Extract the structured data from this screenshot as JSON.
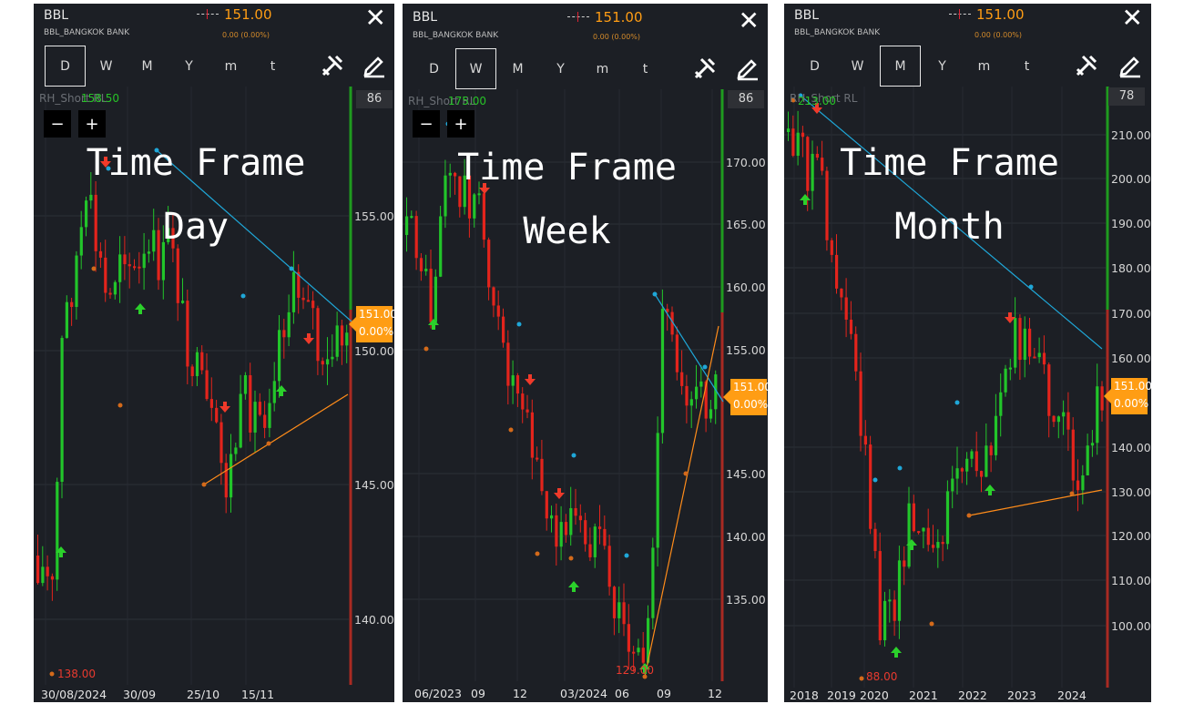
{
  "panels": [
    {
      "symbol": "BBL",
      "subtitle": "BBL_BANGKOK BANK",
      "price": "151.00",
      "change": "0.00 (0.00%)",
      "timeframes": [
        "D",
        "W",
        "M",
        "Y",
        "m",
        "t"
      ],
      "selected": 0,
      "indicator": "RH_Short RL",
      "top_value": "86",
      "high_label": "158.50",
      "low_label": "138.00",
      "overlay_line1": "Time Frame",
      "overlay_line2": "Day",
      "zoom_minus": "−",
      "zoom_plus": "+",
      "price_tag": "151.00",
      "price_tag_pct": "0.00%",
      "y_labels": [
        "155.00",
        "150.00",
        "145.00",
        "140.00"
      ],
      "x_labels": [
        "30/08/2024",
        "30/09",
        "25/10",
        "15/11"
      ]
    },
    {
      "symbol": "BBL",
      "subtitle": "BBL_BANGKOK BANK",
      "price": "151.00",
      "change": "0.00 (0.00%)",
      "timeframes": [
        "D",
        "W",
        "M",
        "Y",
        "m",
        "t"
      ],
      "selected": 1,
      "indicator": "RH_Short RL",
      "top_value": "86",
      "high_label": "175.00",
      "low_label": "129.00",
      "overlay_line1": "Time Frame",
      "overlay_line2": "Week",
      "zoom_minus": "−",
      "zoom_plus": "+",
      "price_tag": "151.00",
      "price_tag_pct": "0.00%",
      "y_labels": [
        "170.00",
        "165.00",
        "160.00",
        "155.00",
        "145.00",
        "140.00",
        "135.00"
      ],
      "x_labels": [
        "06/2023",
        "09",
        "12",
        "03/2024",
        "06",
        "09",
        "12"
      ]
    },
    {
      "symbol": "BBL",
      "subtitle": "BBL_BANGKOK BANK",
      "price": "151.00",
      "change": "0.00 (0.00%)",
      "timeframes": [
        "D",
        "W",
        "M",
        "Y",
        "m",
        "t"
      ],
      "selected": 2,
      "indicator": "RH_Short RL",
      "top_value": "78",
      "high_label": "213.00",
      "low_label": "88.00",
      "overlay_line1": "Time Frame",
      "overlay_line2": "Month",
      "price_tag": "151.00",
      "price_tag_pct": "0.00%",
      "y_labels": [
        "210.00",
        "200.00",
        "190.00",
        "180.00",
        "170.00",
        "160.00",
        "140.00",
        "130.00",
        "120.00",
        "110.00",
        "100.00"
      ],
      "x_labels": [
        "2018",
        "2019",
        "2020",
        "2021",
        "2022",
        "2023",
        "2024"
      ]
    }
  ],
  "colors": {
    "up": "#22c52a",
    "down": "#e3241c",
    "price_accent": "#ff9d14",
    "resistance_line": "#1fa7d8",
    "support_line": "#ff8c1a",
    "background": "#1c1f25"
  },
  "icons": [
    "close-icon",
    "tools-icon",
    "draw-icon"
  ]
}
